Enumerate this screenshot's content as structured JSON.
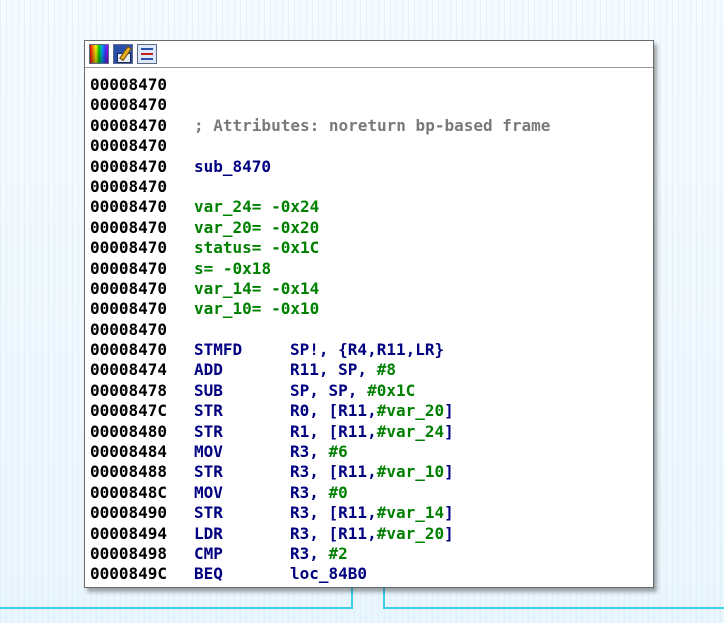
{
  "toolbar": {
    "icons": [
      "color-palette-icon",
      "rename-pencil-icon",
      "graph-view-icon"
    ]
  },
  "listing": [
    {
      "addr": "00008470",
      "kind": "blank"
    },
    {
      "addr": "00008470",
      "kind": "blank"
    },
    {
      "addr": "00008470",
      "kind": "comment",
      "text": "; Attributes: noreturn bp-based frame"
    },
    {
      "addr": "00008470",
      "kind": "blank"
    },
    {
      "addr": "00008470",
      "kind": "label",
      "text": "sub_8470"
    },
    {
      "addr": "00008470",
      "kind": "blank"
    },
    {
      "addr": "00008470",
      "kind": "var",
      "name": "var_24",
      "value": "-0x24"
    },
    {
      "addr": "00008470",
      "kind": "var",
      "name": "var_20",
      "value": "-0x20"
    },
    {
      "addr": "00008470",
      "kind": "var",
      "name": "status",
      "value": "-0x1C"
    },
    {
      "addr": "00008470",
      "kind": "var",
      "name": "s",
      "value": "-0x18"
    },
    {
      "addr": "00008470",
      "kind": "var",
      "name": "var_14",
      "value": "-0x14"
    },
    {
      "addr": "00008470",
      "kind": "var",
      "name": "var_10",
      "value": "-0x10"
    },
    {
      "addr": "00008470",
      "kind": "blank"
    },
    {
      "addr": "00008470",
      "kind": "insn",
      "mnem": "STMFD",
      "parts": [
        [
          "o",
          "SP!, {R4,R11,LR}"
        ]
      ]
    },
    {
      "addr": "00008474",
      "kind": "insn",
      "mnem": "ADD",
      "parts": [
        [
          "o",
          "R11, SP, "
        ],
        [
          "n",
          "#8"
        ]
      ]
    },
    {
      "addr": "00008478",
      "kind": "insn",
      "mnem": "SUB",
      "parts": [
        [
          "o",
          "SP, SP, "
        ],
        [
          "n",
          "#0x1C"
        ]
      ]
    },
    {
      "addr": "0000847C",
      "kind": "insn",
      "mnem": "STR",
      "parts": [
        [
          "o",
          "R0, [R11,"
        ],
        [
          "n",
          "#var_20"
        ],
        [
          "o",
          "]"
        ]
      ]
    },
    {
      "addr": "00008480",
      "kind": "insn",
      "mnem": "STR",
      "parts": [
        [
          "o",
          "R1, [R11,"
        ],
        [
          "n",
          "#var_24"
        ],
        [
          "o",
          "]"
        ]
      ]
    },
    {
      "addr": "00008484",
      "kind": "insn",
      "mnem": "MOV",
      "parts": [
        [
          "o",
          "R3, "
        ],
        [
          "n",
          "#6"
        ]
      ]
    },
    {
      "addr": "00008488",
      "kind": "insn",
      "mnem": "STR",
      "parts": [
        [
          "o",
          "R3, [R11,"
        ],
        [
          "n",
          "#var_10"
        ],
        [
          "o",
          "]"
        ]
      ]
    },
    {
      "addr": "0000848C",
      "kind": "insn",
      "mnem": "MOV",
      "parts": [
        [
          "o",
          "R3, "
        ],
        [
          "n",
          "#0"
        ]
      ]
    },
    {
      "addr": "00008490",
      "kind": "insn",
      "mnem": "STR",
      "parts": [
        [
          "o",
          "R3, [R11,"
        ],
        [
          "n",
          "#var_14"
        ],
        [
          "o",
          "]"
        ]
      ]
    },
    {
      "addr": "00008494",
      "kind": "insn",
      "mnem": "LDR",
      "parts": [
        [
          "o",
          "R3, [R11,"
        ],
        [
          "n",
          "#var_20"
        ],
        [
          "o",
          "]"
        ]
      ]
    },
    {
      "addr": "00008498",
      "kind": "insn",
      "mnem": "CMP",
      "parts": [
        [
          "o",
          "R3, "
        ],
        [
          "n",
          "#2"
        ]
      ]
    },
    {
      "addr": "0000849C",
      "kind": "insn",
      "mnem": "BEQ",
      "parts": [
        [
          "o",
          "loc_84B0"
        ]
      ]
    }
  ],
  "colors": {
    "address": "#000000",
    "mnemonic": "#000080",
    "operand": "#000080",
    "number": "#008000",
    "comment": "#7a7a7a",
    "edge": "#3fd0e8"
  }
}
